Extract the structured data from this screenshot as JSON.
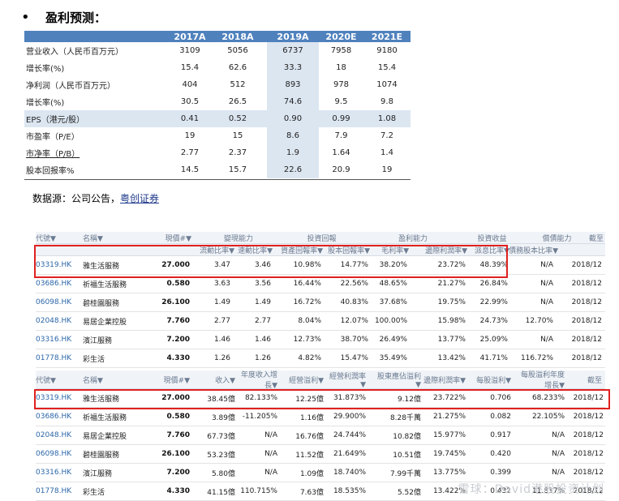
{
  "heading": {
    "bullet": "•",
    "title": "盈利预测："
  },
  "forecast": {
    "headers": [
      "2017A",
      "2018A",
      "2019A",
      "2020E",
      "2021E"
    ],
    "rows": [
      {
        "label": "营业收入（人民币百万元）",
        "values": [
          "3109",
          "5056",
          "6737",
          "7958",
          "9180"
        ]
      },
      {
        "label": "增长率(%)",
        "values": [
          "15.4",
          "62.6",
          "33.3",
          "18",
          "15.4"
        ]
      },
      {
        "label": "净利润（人民币百万元）",
        "values": [
          "404",
          "512",
          "893",
          "978",
          "1074"
        ]
      },
      {
        "label": "增长率(%)",
        "values": [
          "30.5",
          "26.5",
          "74.6",
          "9.5",
          "9.8"
        ]
      },
      {
        "label": "EPS（港元/股）",
        "values": [
          "0.41",
          "0.52",
          "0.90",
          "0.99",
          "1.08"
        ]
      },
      {
        "label": "市盈率（P/E）",
        "values": [
          "19",
          "15",
          "8.6",
          "7.9",
          "7.2"
        ]
      },
      {
        "label": "市净率（P/B）",
        "values": [
          "2.77",
          "2.37",
          "1.9",
          "1.64",
          "1.4"
        ]
      },
      {
        "label": "股本回报率%",
        "values": [
          "14.5",
          "15.7",
          "22.6",
          "20.9",
          "19"
        ]
      }
    ]
  },
  "source": {
    "prefix": "数据源：公司公告，",
    "link": "粤创证券"
  },
  "table1": {
    "group_headers": [
      "代號▼",
      "名稱▼",
      "現價#▼",
      "變現能力",
      "投資回報",
      "盈利能力",
      "投資收益",
      "償債能力",
      "截至"
    ],
    "sub_headers": [
      "流動比率▼",
      "速動比率▼",
      "資產回報率▼",
      "股本回報率▼",
      "毛利率▼",
      "邊際利潤率▼",
      "派息比率▼",
      "債務股本比率▼"
    ],
    "rows": [
      [
        "03319.HK",
        "雅生活服務",
        "27.000",
        "3.47",
        "3.46",
        "10.98%",
        "14.77%",
        "38.20%",
        "23.72%",
        "48.39%",
        "N/A",
        "2018/12"
      ],
      [
        "03686.HK",
        "祈福生活服務",
        "0.580",
        "3.63",
        "3.56",
        "16.44%",
        "22.56%",
        "48.65%",
        "21.27%",
        "26.84%",
        "N/A",
        "2018/12"
      ],
      [
        "06098.HK",
        "碧桂園服務",
        "26.100",
        "1.49",
        "1.49",
        "16.72%",
        "40.83%",
        "37.68%",
        "19.75%",
        "22.99%",
        "N/A",
        "2018/12"
      ],
      [
        "02048.HK",
        "易居企業控股",
        "7.760",
        "2.77",
        "2.77",
        "8.04%",
        "12.07%",
        "100.00%",
        "15.98%",
        "24.73%",
        "12.70%",
        "2018/12"
      ],
      [
        "03316.HK",
        "濱江服務",
        "7.200",
        "1.46",
        "1.46",
        "12.73%",
        "38.70%",
        "26.49%",
        "13.77%",
        "25.09%",
        "N/A",
        "2018/12"
      ],
      [
        "01778.HK",
        "彩生活",
        "4.330",
        "1.26",
        "1.26",
        "4.82%",
        "15.47%",
        "35.49%",
        "13.42%",
        "41.71%",
        "116.72%",
        "2018/12"
      ]
    ]
  },
  "table2": {
    "headers": [
      "代號▼",
      "名稱▼",
      "現價#▼",
      "收入▼",
      "年度收入增長▼",
      "經營溢利▼",
      "經營利潤率▼",
      "股東應佔溢利▼",
      "邊際利潤率▼",
      "每股溢利▼",
      "每股溢利年度增長▼",
      "截至"
    ],
    "rows": [
      [
        "03319.HK",
        "雅生活服務",
        "27.000",
        "38.45億",
        "82.133%",
        "12.25億",
        "31.873%",
        "9.12億",
        "23.722%",
        "0.706",
        "68.233%",
        "2018/12"
      ],
      [
        "03686.HK",
        "祈福生活服務",
        "0.580",
        "3.89億",
        "-11.205%",
        "1.16億",
        "29.900%",
        "8.28千萬",
        "21.275%",
        "0.082",
        "22.105%",
        "2018/12"
      ],
      [
        "02048.HK",
        "易居企業控股",
        "7.760",
        "67.73億",
        "N/A",
        "16.76億",
        "24.744%",
        "10.82億",
        "15.977%",
        "0.917",
        "N/A",
        "2018/12"
      ],
      [
        "06098.HK",
        "碧桂園服務",
        "26.100",
        "53.23億",
        "N/A",
        "11.52億",
        "21.649%",
        "10.51億",
        "19.745%",
        "0.420",
        "N/A",
        "2018/12"
      ],
      [
        "03316.HK",
        "濱江服務",
        "7.200",
        "5.80億",
        "N/A",
        "1.09億",
        "18.740%",
        "7.99千萬",
        "13.775%",
        "0.399",
        "N/A",
        "2018/12"
      ],
      [
        "01778.HK",
        "彩生活",
        "4.330",
        "41.15億",
        "110.715%",
        "7.63億",
        "18.535%",
        "5.52億",
        "13.422%",
        "0.432",
        "11.817%",
        "2018/12"
      ]
    ]
  },
  "watermark": "雪球：David港股投资计划"
}
